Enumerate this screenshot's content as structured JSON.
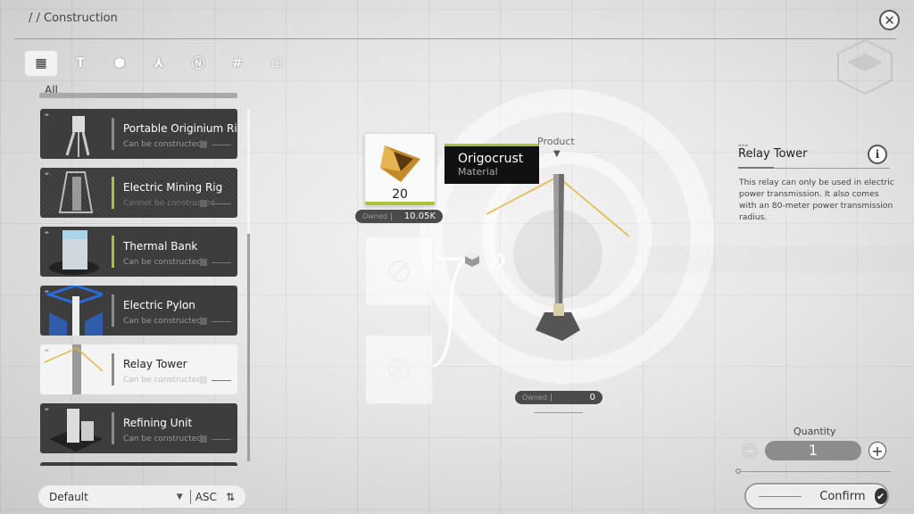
{
  "header": {
    "breadcrumb": "/ / Construction",
    "close_icon": "close-icon"
  },
  "categories": {
    "tabs": [
      {
        "icon": "grid-icon",
        "glyph": "▦",
        "active": true
      },
      {
        "icon": "pickaxe-icon",
        "glyph": "T",
        "active": false
      },
      {
        "icon": "gear-icon",
        "glyph": "⬢",
        "active": false
      },
      {
        "icon": "tri-branch-icon",
        "glyph": "⅄",
        "active": false
      },
      {
        "icon": "power-icon",
        "glyph": "Ⓝ",
        "active": false
      },
      {
        "icon": "hash-icon",
        "glyph": "#",
        "active": false
      },
      {
        "icon": "robot-icon",
        "glyph": "☖",
        "active": false
      }
    ],
    "selected_label": "All"
  },
  "list": {
    "items": [
      {
        "name": "Portable Originium Rig",
        "status": "Can be constructed",
        "selected": false,
        "buildable": true,
        "accent": "gray"
      },
      {
        "name": "Electric Mining Rig",
        "status": "Cannot be constructed",
        "selected": false,
        "buildable": false,
        "accent": "green"
      },
      {
        "name": "Thermal Bank",
        "status": "Can be constructed",
        "selected": false,
        "buildable": true,
        "accent": "green"
      },
      {
        "name": "Electric Pylon",
        "status": "Can be constructed",
        "selected": false,
        "buildable": true,
        "accent": "gray"
      },
      {
        "name": "Relay Tower",
        "status": "Can be constructed",
        "selected": true,
        "buildable": true,
        "accent": "gray"
      },
      {
        "name": "Refining Unit",
        "status": "Can be constructed",
        "selected": false,
        "buildable": true,
        "accent": "gray"
      }
    ]
  },
  "sort": {
    "selected": "Default",
    "order": "ASC"
  },
  "recipe": {
    "ingredient": {
      "name": "Origocrust",
      "type": "Material",
      "required": "20",
      "owned_label": "Owned",
      "owned_value": "10.05K"
    },
    "product_label": "Product",
    "product_owned_label": "Owned",
    "product_owned_value": "0"
  },
  "detail": {
    "title": "Relay Tower",
    "description": "This relay can only be used in electric power transmission. It also comes with an 80-meter power transmission radius."
  },
  "quantity": {
    "label": "Quantity",
    "value": "1",
    "minus": "−",
    "plus": "+"
  },
  "confirm": {
    "label": "Confirm",
    "check": "✔"
  },
  "colors": {
    "accent_green": "#a8c23a",
    "card_dark": "#3d3d3d",
    "tooltip_bg": "#111111"
  }
}
